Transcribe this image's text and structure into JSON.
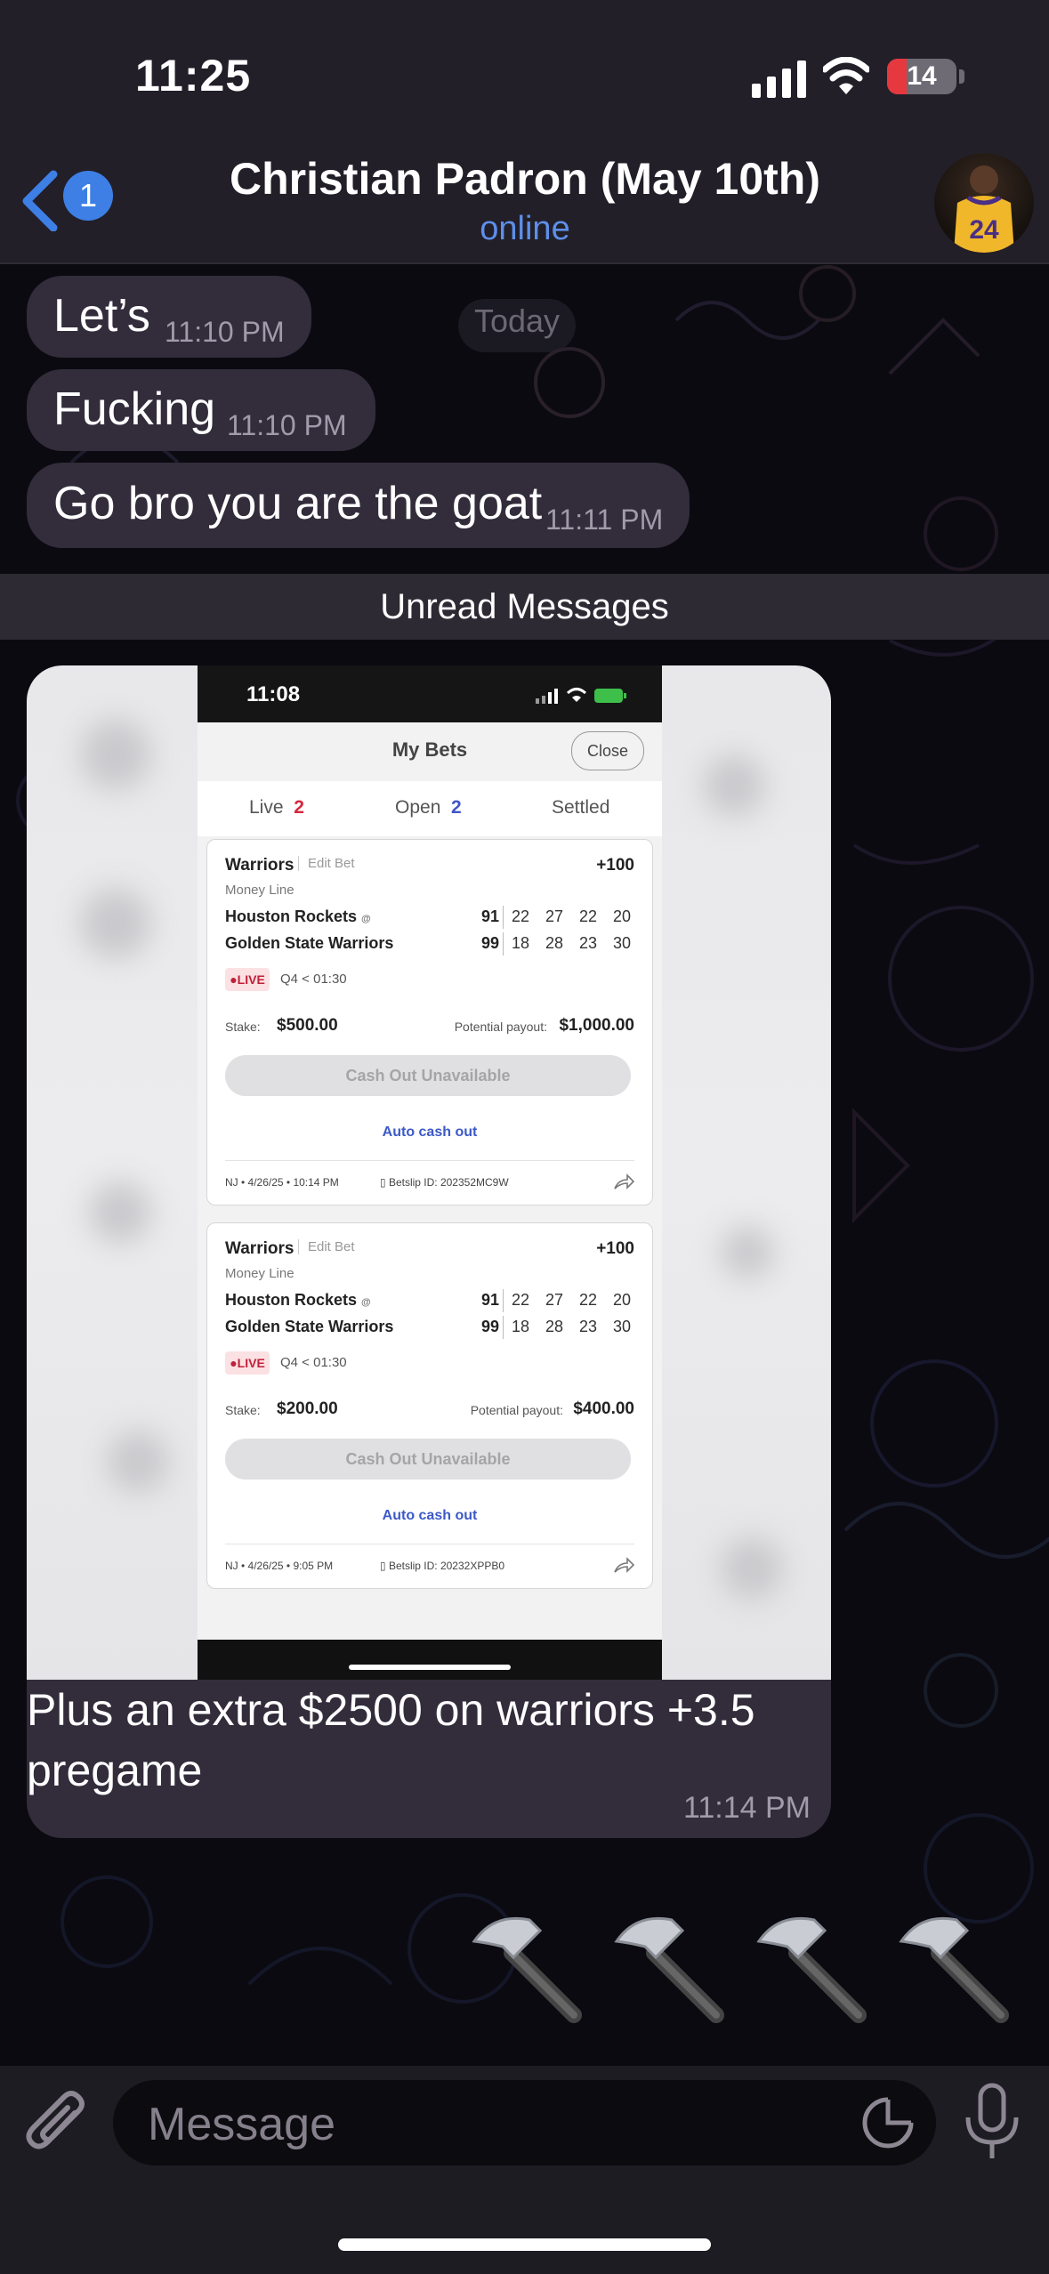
{
  "status_bar": {
    "time": "11:25",
    "battery": "14"
  },
  "header": {
    "back_badge": "1",
    "contact_name": "Christian Padron (May 10th)",
    "status": "online"
  },
  "chat": {
    "date_pill": "Today",
    "messages": [
      {
        "text": "Let’s",
        "time": "11:10 PM"
      },
      {
        "text": "Fucking",
        "time": "11:10 PM"
      },
      {
        "text": "Go bro you are the goat",
        "time": "11:11 PM"
      }
    ],
    "unread_divider": "Unread Messages",
    "media_message": {
      "caption": "Plus an extra $2500 on warriors +3.5 pregame",
      "time": "11:14 PM",
      "screenshot": {
        "time": "11:08",
        "title": "My Bets",
        "close": "Close",
        "tabs": [
          {
            "label": "Live",
            "count": "2"
          },
          {
            "label": "Open",
            "count": "2"
          },
          {
            "label": "Settled"
          }
        ],
        "bets": [
          {
            "team": "Warriors",
            "edit": "Edit Bet",
            "odds": "+100",
            "market": "Money Line",
            "away": {
              "name": "Houston Rockets",
              "at": "@",
              "total": "91",
              "q": [
                "22",
                "27",
                "22",
                "20"
              ]
            },
            "home": {
              "name": "Golden State Warriors",
              "total": "99",
              "q": [
                "18",
                "28",
                "23",
                "30"
              ]
            },
            "live": "LIVE",
            "clock": "Q4 < 01:30",
            "stake_label": "Stake:",
            "stake": "$500.00",
            "payout_label": "Potential payout:",
            "payout": "$1,000.00",
            "cashout": "Cash Out Unavailable",
            "auto": "Auto cash out",
            "footer": "NJ • 4/26/25 • 10:14 PM",
            "betslip": "Betslip ID: 202352MC9W"
          },
          {
            "team": "Warriors",
            "edit": "Edit Bet",
            "odds": "+100",
            "market": "Money Line",
            "away": {
              "name": "Houston Rockets",
              "at": "@",
              "total": "91",
              "q": [
                "22",
                "27",
                "22",
                "20"
              ]
            },
            "home": {
              "name": "Golden State Warriors",
              "total": "99",
              "q": [
                "18",
                "28",
                "23",
                "30"
              ]
            },
            "live": "LIVE",
            "clock": "Q4 < 01:30",
            "stake_label": "Stake:",
            "stake": "$200.00",
            "payout_label": "Potential payout:",
            "payout": "$400.00",
            "cashout": "Cash Out Unavailable",
            "auto": "Auto cash out",
            "footer": "NJ • 4/26/25 • 9:05 PM",
            "betslip": "Betslip ID: 20232XPPB0"
          }
        ]
      }
    },
    "reaction_emoji": [
      "hammer",
      "hammer",
      "hammer",
      "hammer"
    ]
  },
  "composer": {
    "placeholder": "Message"
  },
  "colors": {
    "bubble": "#322c3b",
    "header_bg": "#221f29",
    "accent_blue": "#3e7fe6",
    "live_red": "#c0203a"
  }
}
